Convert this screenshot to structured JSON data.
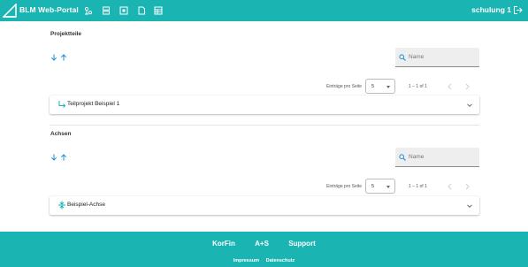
{
  "header": {
    "app_title": "BLM Web-Portal",
    "nav_icons": [
      "people-hierarchy-icon",
      "server-icon",
      "box-icon",
      "document-icon",
      "table-icon"
    ],
    "user_name": "schulung 1",
    "accent_color": "#1ab5b3"
  },
  "projektteile": {
    "title": "Projektteile",
    "search_placeholder": "Name",
    "pager": {
      "label": "Einträge pro Seite",
      "page_size": "5",
      "range": "1 – 1 of 1"
    },
    "items": [
      {
        "label": "Teilprojekt Beispiel 1",
        "icon": "subdirectory-arrow-icon"
      }
    ]
  },
  "achsen": {
    "title": "Achsen",
    "search_placeholder": "Name",
    "pager": {
      "label": "Einträge pro Seite",
      "page_size": "5",
      "range": "1 – 1 of 1"
    },
    "items": [
      {
        "label": "Beispiel-Achse",
        "icon": "vertical-split-icon"
      }
    ]
  },
  "footer": {
    "links": [
      "KorFin",
      "A+S",
      "Support"
    ],
    "legal": [
      "Impressum",
      "Datenschutz"
    ]
  }
}
